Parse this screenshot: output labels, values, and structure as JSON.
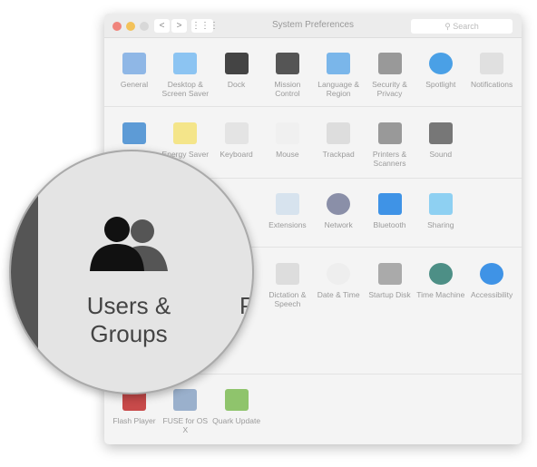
{
  "window": {
    "title": "System Preferences",
    "search_placeholder": "Search",
    "back": "<",
    "forward": ">",
    "grid": "⋮⋮⋮"
  },
  "rows": [
    [
      {
        "label": "General",
        "icon": "general-icon",
        "color": "#8fb7e6"
      },
      {
        "label": "Desktop & Screen Saver",
        "icon": "desktop-icon",
        "color": "#8cc4f2"
      },
      {
        "label": "Dock",
        "icon": "dock-icon",
        "color": "#444"
      },
      {
        "label": "Mission Control",
        "icon": "mission-control-icon",
        "color": "#555"
      },
      {
        "label": "Language & Region",
        "icon": "flag-icon",
        "color": "#7ab6ea"
      },
      {
        "label": "Security & Privacy",
        "icon": "house-lock-icon",
        "color": "#999"
      },
      {
        "label": "Spotlight",
        "icon": "magnifier-icon",
        "color": "#4aa0e6"
      },
      {
        "label": "Notifications",
        "icon": "notifications-icon",
        "color": "#e0e0e0"
      }
    ],
    [
      {
        "label": "Displays",
        "icon": "display-icon",
        "color": "#5d9bd6"
      },
      {
        "label": "Energy Saver",
        "icon": "bulb-icon",
        "color": "#f4e58a"
      },
      {
        "label": "Keyboard",
        "icon": "keyboard-icon",
        "color": "#e4e4e4"
      },
      {
        "label": "Mouse",
        "icon": "mouse-icon",
        "color": "#f0f0f0"
      },
      {
        "label": "Trackpad",
        "icon": "trackpad-icon",
        "color": "#ddd"
      },
      {
        "label": "Printers & Scanners",
        "icon": "printer-icon",
        "color": "#999"
      },
      {
        "label": "Sound",
        "icon": "speaker-icon",
        "color": "#777"
      }
    ],
    [
      {
        "label": "Extensions",
        "icon": "puzzle-icon",
        "color": "#d7e3ee"
      },
      {
        "label": "Network",
        "icon": "globe-icon",
        "color": "#8a8fa8"
      },
      {
        "label": "Bluetooth",
        "icon": "bluetooth-icon",
        "color": "#3f93e6"
      },
      {
        "label": "Sharing",
        "icon": "folder-icon",
        "color": "#8ed0f2"
      }
    ],
    [
      {
        "label": "Dictation & Speech",
        "icon": "microphone-icon",
        "color": "#ddd"
      },
      {
        "label": "Date & Time",
        "icon": "clock-icon",
        "color": "#eee"
      },
      {
        "label": "Startup Disk",
        "icon": "disk-icon",
        "color": "#aaa"
      },
      {
        "label": "Time Machine",
        "icon": "time-machine-icon",
        "color": "#4d8f86"
      },
      {
        "label": "Accessibility",
        "icon": "accessibility-icon",
        "color": "#3f93e6"
      }
    ],
    [
      {
        "label": "Flash Player",
        "icon": "flash-icon",
        "color": "#c84a4a"
      },
      {
        "label": "FUSE for OS X",
        "icon": "fuse-icon",
        "color": "#9ab0cc"
      },
      {
        "label": "Quark Update",
        "icon": "quark-icon",
        "color": "#8fc46c"
      }
    ]
  ],
  "magnifier": {
    "label": "Users & Groups",
    "partial": "P",
    "icon": "users-icon"
  }
}
